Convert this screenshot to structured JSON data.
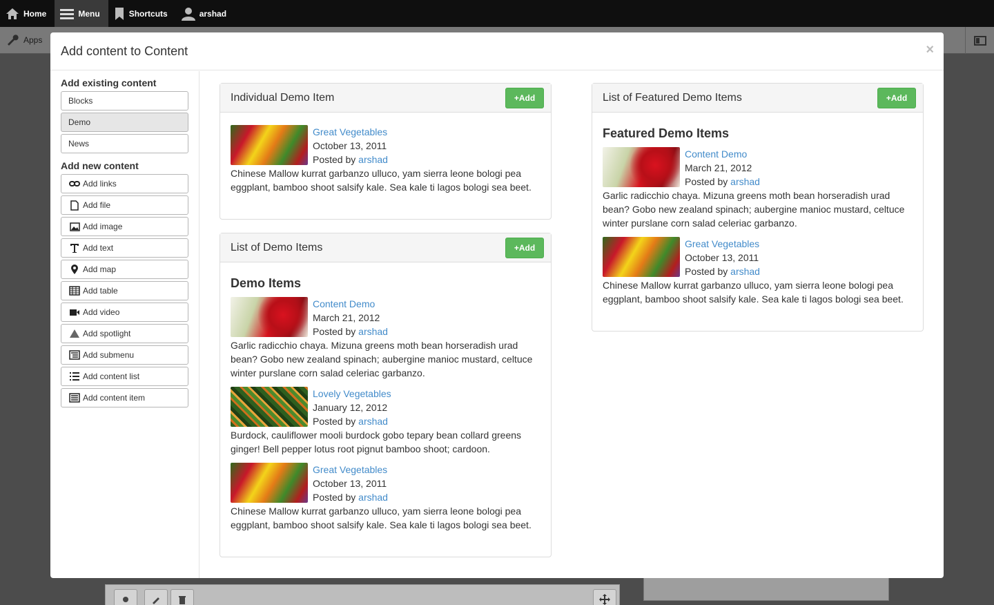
{
  "toolbar": {
    "home": "Home",
    "menu": "Menu",
    "shortcuts": "Shortcuts",
    "user": "arshad"
  },
  "subbar": {
    "apps": "Apps"
  },
  "modal": {
    "title": "Add content to Content",
    "close": "×"
  },
  "sidebar": {
    "existing_heading": "Add existing content",
    "existing": [
      "Blocks",
      "Demo",
      "News"
    ],
    "selected_existing": "Demo",
    "new_heading": "Add new content",
    "new_items": [
      {
        "label": "Add links",
        "icon": "link-icon"
      },
      {
        "label": "Add file",
        "icon": "file-icon"
      },
      {
        "label": "Add image",
        "icon": "image-icon"
      },
      {
        "label": "Add text",
        "icon": "text-icon"
      },
      {
        "label": "Add map",
        "icon": "map-marker-icon"
      },
      {
        "label": "Add table",
        "icon": "table-icon"
      },
      {
        "label": "Add video",
        "icon": "video-icon"
      },
      {
        "label": "Add spotlight",
        "icon": "spotlight-icon"
      },
      {
        "label": "Add submenu",
        "icon": "submenu-icon"
      },
      {
        "label": "Add content list",
        "icon": "list-icon"
      },
      {
        "label": "Add content item",
        "icon": "content-item-icon"
      }
    ]
  },
  "add_label": "Add",
  "posted_by": "Posted by",
  "panels": {
    "individual": {
      "title": "Individual Demo Item",
      "item": {
        "title": "Great Vegetables",
        "date": "October 13, 2011",
        "author": "arshad",
        "text": "Chinese Mallow kurrat garbanzo ulluco, yam sierra leone bologi pea eggplant, bamboo shoot salsify kale. Sea kale ti lagos bologi sea beet."
      }
    },
    "list": {
      "title": "List of Demo Items",
      "heading": "Demo Items",
      "items": [
        {
          "title": "Content Demo",
          "date": "March 21, 2012",
          "author": "arshad",
          "text": "Garlic radicchio chaya. Mizuna greens moth bean horseradish urad bean? Gobo new zealand spinach; aubergine manioc mustard, celtuce winter purslane corn salad celeriac garbanzo."
        },
        {
          "title": "Lovely Vegetables",
          "date": "January 12, 2012",
          "author": "arshad",
          "text": "Burdock, cauliflower mooli burdock gobo tepary bean collard greens ginger! Bell pepper lotus root pignut bamboo shoot; cardoon."
        },
        {
          "title": "Great Vegetables",
          "date": "October 13, 2011",
          "author": "arshad",
          "text": "Chinese Mallow kurrat garbanzo ulluco, yam sierra leone bologi pea eggplant, bamboo shoot salsify kale. Sea kale ti lagos bologi sea beet."
        }
      ]
    },
    "featured": {
      "title": "List of Featured Demo Items",
      "heading": "Featured Demo Items",
      "items": [
        {
          "title": "Content Demo",
          "date": "March 21, 2012",
          "author": "arshad",
          "text": "Garlic radicchio chaya. Mizuna greens moth bean horseradish urad bean? Gobo new zealand spinach; aubergine manioc mustard, celtuce winter purslane corn salad celeriac garbanzo."
        },
        {
          "title": "Great Vegetables",
          "date": "October 13, 2011",
          "author": "arshad",
          "text": "Chinese Mallow kurrat garbanzo ulluco, yam sierra leone bologi pea eggplant, bamboo shoot salsify kale. Sea kale ti lagos bologi sea beet."
        }
      ]
    }
  },
  "colors": {
    "add_button": "#5cb85c",
    "link": "#428bca",
    "toolbar": "#0f0f0f"
  }
}
